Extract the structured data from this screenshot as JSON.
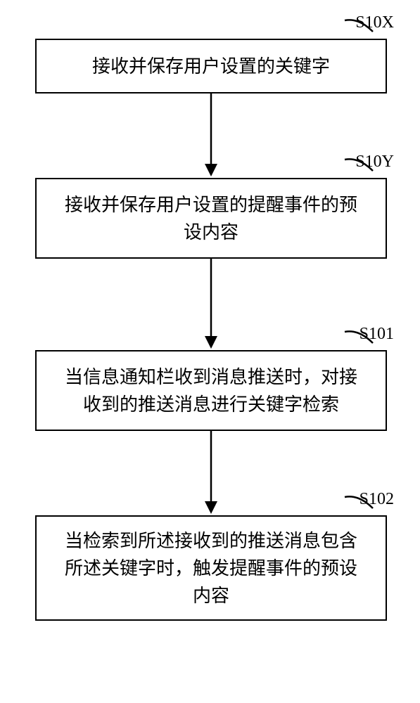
{
  "diagram": {
    "steps": [
      {
        "label": "S10X",
        "text": "接收并保存用户设置的关键字"
      },
      {
        "label": "S10Y",
        "text": "接收并保存用户设置的提醒事件的预设内容"
      },
      {
        "label": "S101",
        "text": "当信息通知栏收到消息推送时，对接收到的推送消息进行关键字检索"
      },
      {
        "label": "S102",
        "text": "当检索到所述接收到的推送消息包含所述关键字时，触发提醒事件的预设内容"
      }
    ]
  }
}
